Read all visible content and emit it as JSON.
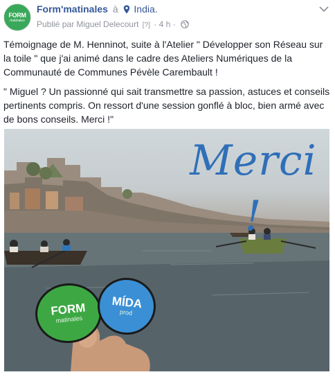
{
  "header": {
    "avatar": {
      "line1": "FORM",
      "line2": "matinales",
      "color": "#3aa85a"
    },
    "page_name": "Form'matinales",
    "at_word": "à",
    "location": "India.",
    "published_by": "Publié par Miguel Delecourt",
    "help_mark": "[?]",
    "separator": "·",
    "time": "4 h",
    "separator2": "·"
  },
  "post": {
    "paragraph1": "Témoignage de M. Henninot, suite à l'Atelier \" Développer son Réseau sur la toile \" que j'ai animé dans le cadre des Ateliers Numériques de la Communauté de Communes Pévèle Carembault !",
    "paragraph2": "\" Miguel ? Un passionné qui sait transmettre sa passion, astuces et conseils pertinents compris. On ressort d'une session gonflé à bloc, bien armé avec de bons conseils. Merci !\""
  },
  "photo": {
    "merci_text": "Merci !",
    "merci_color": "#2f6fb8",
    "sticker_form": {
      "big": "FORM",
      "small": "matinales",
      "color": "#3da843"
    },
    "sticker_mida": {
      "big": "MÍDA",
      "small": "prod",
      "color": "#3b8fd4"
    }
  },
  "colors": {
    "link": "#365899",
    "meta": "#90949c",
    "text": "#1d2129"
  }
}
